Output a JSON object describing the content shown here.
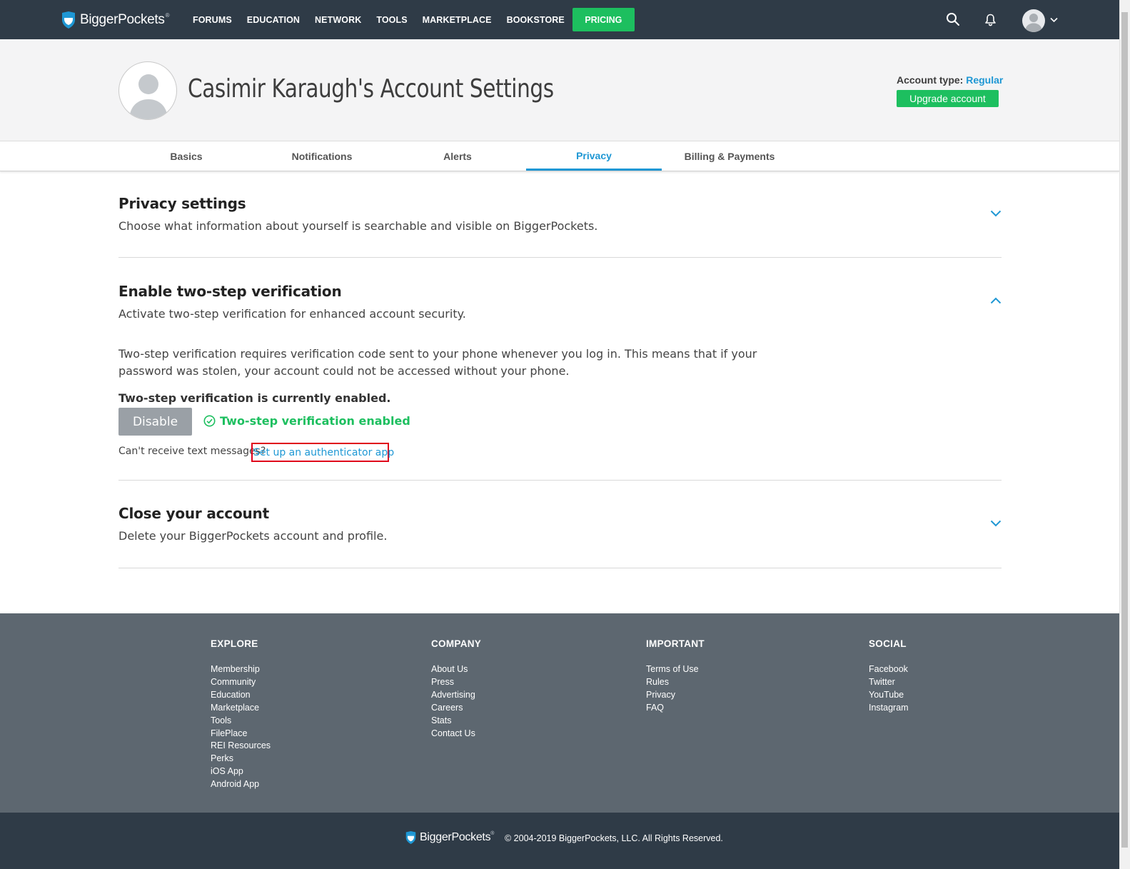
{
  "topnav": {
    "brand": "BiggerPockets",
    "brand_mark": "®",
    "items": [
      "FORUMS",
      "EDUCATION",
      "NETWORK",
      "TOOLS",
      "MARKETPLACE",
      "BOOKSTORE"
    ],
    "pricing_label": "PRICING",
    "icons": [
      "search-icon",
      "bell-icon",
      "avatar",
      "chevron-down-icon"
    ]
  },
  "header": {
    "title": "Casimir Karaugh's Account Settings",
    "account_type_label": "Account type:",
    "account_type_value": "Regular",
    "upgrade_label": "Upgrade account"
  },
  "tabs": [
    {
      "label": "Basics",
      "active": false
    },
    {
      "label": "Notifications",
      "active": false
    },
    {
      "label": "Alerts",
      "active": false
    },
    {
      "label": "Privacy",
      "active": true
    },
    {
      "label": "Billing & Payments",
      "active": false
    }
  ],
  "sections": {
    "privacy": {
      "title": "Privacy settings",
      "desc": "Choose what information about yourself is searchable and visible on BiggerPockets.",
      "expanded": false
    },
    "two_step": {
      "title": "Enable two-step verification",
      "desc": "Activate two-step verification for enhanced account security.",
      "expanded": true,
      "body": "Two-step verification requires verification code sent to your phone whenever you log in. This means that if your password was stolen, your account could not be accessed without your phone.",
      "enabled_heading": "Two-step verification is currently enabled.",
      "disable_label": "Disable",
      "status_text": "Two-step verification enabled",
      "cant_receive": "Can't receive text messages?",
      "auth_link": "Set up an authenticator app"
    },
    "close": {
      "title": "Close your account",
      "desc": "Delete your BiggerPockets account and profile.",
      "expanded": false
    }
  },
  "footer": {
    "explore": {
      "title": "EXPLORE",
      "links": [
        "Membership",
        "Community",
        "Education",
        "Marketplace",
        "Tools",
        "FilePlace",
        "REI Resources",
        "Perks",
        "iOS App",
        "Android App"
      ]
    },
    "company": {
      "title": "COMPANY",
      "links": [
        "About Us",
        "Press",
        "Advertising",
        "Careers",
        "Stats",
        "Contact Us"
      ]
    },
    "important": {
      "title": "IMPORTANT",
      "links": [
        "Terms of Use",
        "Rules",
        "Privacy",
        "FAQ"
      ]
    },
    "social": {
      "title": "SOCIAL",
      "links": [
        "Facebook",
        "Twitter",
        "YouTube",
        "Instagram"
      ]
    },
    "brand": "BiggerPockets",
    "brand_mark": "®",
    "copyright": "© 2004-2019 BiggerPockets, LLC. All Rights Reserved."
  },
  "colors": {
    "nav_bg": "#2f3b47",
    "accent_green": "#1dbf5f",
    "accent_blue": "#1e97d4",
    "footer_bg": "#5d6770",
    "highlight_red": "#e0001b"
  }
}
